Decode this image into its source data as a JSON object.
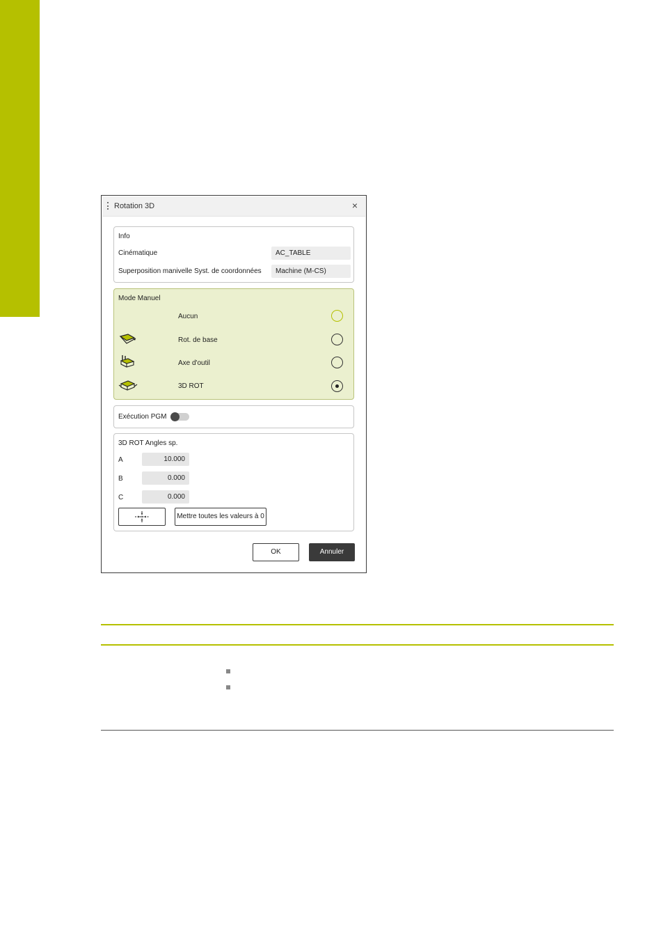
{
  "dialog": {
    "title": "Rotation 3D",
    "close": "×",
    "info": {
      "heading": "Info",
      "kinematics_label": "Cinématique",
      "kinematics_value": "AC_TABLE",
      "overlay_label": "Superposition manivelle Syst. de coordonnées",
      "overlay_value": "Machine (M-CS)"
    },
    "mode": {
      "heading": "Mode Manuel",
      "options": [
        {
          "label": "Aucun",
          "icon": "none",
          "selected": false
        },
        {
          "label": "Rot. de base",
          "icon": "base-rotation-icon",
          "selected": false
        },
        {
          "label": "Axe d'outil",
          "icon": "tool-axis-icon",
          "selected": false
        },
        {
          "label": "3D ROT",
          "icon": "3d-rot-icon",
          "selected": true
        }
      ]
    },
    "execution": {
      "label": "Exécution PGM",
      "toggle_on": false
    },
    "angles": {
      "heading": "3D ROT Angles sp.",
      "rows": [
        {
          "axis": "A",
          "value": "10.000"
        },
        {
          "axis": "B",
          "value": "0.000"
        },
        {
          "axis": "C",
          "value": "0.000"
        }
      ],
      "reset_label": "Mettre toutes les valeurs à 0"
    },
    "ok_label": "OK",
    "cancel_label": "Annuler"
  },
  "colors": {
    "accent": "#b5c000",
    "mode_bg": "#ebf0cf",
    "dark_button": "#3a3a3a"
  }
}
